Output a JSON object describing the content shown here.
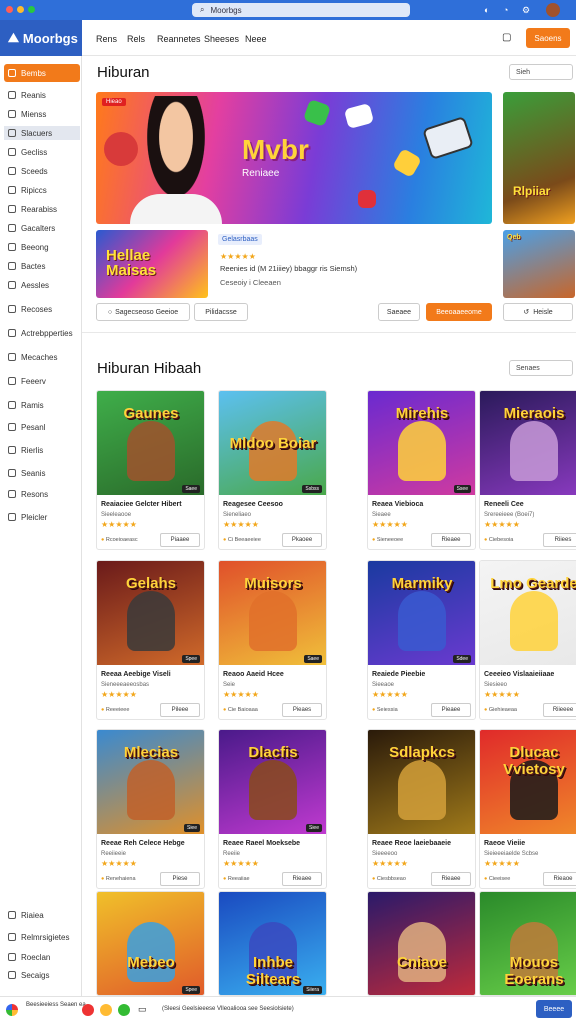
{
  "browser": {
    "url": "Moorbgs",
    "controls": [
      "close",
      "minimize",
      "maximize"
    ]
  },
  "brand": {
    "name": "Moorbgs"
  },
  "sidebar": {
    "items": [
      {
        "label": "Bembs",
        "active": true
      },
      {
        "label": "Reanis"
      },
      {
        "label": "Mienss"
      },
      {
        "label": "Slacuers",
        "selected": true
      },
      {
        "label": "Gecliss"
      },
      {
        "label": "Sceeds"
      },
      {
        "label": "Ripiccs"
      },
      {
        "label": "Rearabiss"
      },
      {
        "label": "Gacalters"
      },
      {
        "label": "Beeong"
      },
      {
        "label": "Bactes"
      },
      {
        "label": "Aessles"
      },
      {
        "label": "Recoses"
      },
      {
        "label": "Actrebpperties"
      },
      {
        "label": "Mecaches"
      },
      {
        "label": "Feeerv"
      },
      {
        "label": "Ramis"
      },
      {
        "label": "Pesanl"
      },
      {
        "label": "Rierlis"
      },
      {
        "label": "Seanis"
      },
      {
        "label": "Resons"
      },
      {
        "label": "Pleicler"
      }
    ],
    "bottom_items": [
      {
        "label": "Riaiea"
      },
      {
        "label": "Relmrsigietes"
      },
      {
        "label": "Roeclan"
      },
      {
        "label": "Secaigs"
      }
    ]
  },
  "topnav": {
    "links": [
      "Rens",
      "Rels",
      "Reannetes",
      "Sheeses",
      "Neee"
    ],
    "login": "Saoens"
  },
  "featured": {
    "title": "Hiburan",
    "sort": "Sieh",
    "hero_tag": "Hieao",
    "hero_title": "Mvbr",
    "hero_sub": "Reniaee",
    "side_title": "Rlpiiar",
    "mini_title": "Hellae Maisas",
    "info_tag": "Gelasrbaas",
    "rating": "★★★★★",
    "desc": "Reenies id (M 21iiiey) bbaggr ris Siemsh)",
    "meta": "Ceseoiy i Cleeaen",
    "buttons": {
      "wishlist": "Sagecseoso Geeioe",
      "play": "Pilidacsse",
      "secondary": "Saeaee",
      "primary": "Beeoaaeeome",
      "more": "Heisle"
    },
    "side2": "Qeb"
  },
  "popular": {
    "title": "Hiburan Hibaah",
    "sort": "Senaes",
    "cards": [
      {
        "title": "Reaiaciee Gelcter Hibert",
        "sub": "Sieeleaooe",
        "meta": "Rcoeioaeasc",
        "btn": "Piaaee",
        "art": "Gaunes",
        "badge": "Saee"
      },
      {
        "title": "Reagesee Ceesoo",
        "sub": "Sieneliaeo",
        "meta": "Ci Beeaeeiee",
        "btn": "Pkaoee",
        "art": "Mldoo Boiar",
        "badge": "Ssbss"
      },
      {
        "title": "Reaea Viebioca",
        "sub": "Sieaee",
        "meta": "Sieneeoee",
        "btn": "Rieaee",
        "art": "Mirehis",
        "badge": "Ssee"
      },
      {
        "title": "Reneeli Cee",
        "sub": "Srereeieee (Boei7)",
        "meta": "Ciebesoia",
        "btn": "Riiees",
        "art": "Mieraois",
        "badge": ""
      },
      {
        "title": "Reeaa Aeebige Viseli",
        "sub": "Sieneeeaeeosbas",
        "meta": "Reeeieee",
        "btn": "Pileee",
        "art": "Gelahs",
        "badge": "Spee"
      },
      {
        "title": "Reaoo Aaeid Hcee",
        "sub": "Seie",
        "meta": "Cie Baioaaa",
        "btn": "Pieaes",
        "art": "Muisors",
        "badge": "Saee"
      },
      {
        "title": "Reaiede Pieebie",
        "sub": "Sieeaoe",
        "meta": "Seiessia",
        "btn": "Pieaee",
        "art": "Marmiky",
        "badge": "Sdee"
      },
      {
        "title": "Ceeeieo Vislaaieiiaae",
        "sub": "Siesieeo",
        "meta": "Giehieaeaa",
        "btn": "Riieeee",
        "art": "Lmo Gearde",
        "badge": ""
      },
      {
        "title": "Reeae Reh Celece Hebge",
        "sub": "Reeiieeie",
        "meta": "Renehaiena",
        "btn": "Piese",
        "art": "Mlecias",
        "badge": "Siee"
      },
      {
        "title": "Reaee Raeel Moeksebe",
        "sub": "Reeiie",
        "meta": "Reeaiiae",
        "btn": "Rieaee",
        "art": "Dlacfis",
        "badge": "Siee"
      },
      {
        "title": "Reaee Reoe laeiebaaeie",
        "sub": "Sieeeeoo",
        "meta": "Ciesbbseao",
        "btn": "Rieaee",
        "art": "Sdlapkcs",
        "badge": ""
      },
      {
        "title": "Raeoe Vieiie",
        "sub": "Sieieeeiaelde Scbse",
        "meta": "Cieeisee",
        "btn": "Rieaoe",
        "art": "Dlucac Vvietosy",
        "badge": ""
      },
      {
        "title": "",
        "sub": "",
        "meta": "",
        "btn": "",
        "art": "Mebeo",
        "badge": "Spee"
      },
      {
        "title": "",
        "sub": "",
        "meta": "",
        "btn": "",
        "art": "Inhbe Siltears",
        "badge": "Siiera"
      },
      {
        "title": "",
        "sub": "",
        "meta": "",
        "btn": "",
        "art": "Cniaoe",
        "badge": ""
      },
      {
        "title": "",
        "sub": "",
        "meta": "",
        "btn": "",
        "art": "Mouos Eoerans",
        "badge": ""
      }
    ]
  },
  "footer": {
    "text": "Beesieeiess Seaen ea",
    "link": "(Sleesi Geelsieeese Vlleoaliooa see Seesiolsiete)",
    "button": "Beeee"
  },
  "colors": {
    "accent": "#f27a1a",
    "brand": "#2d5fc2"
  }
}
